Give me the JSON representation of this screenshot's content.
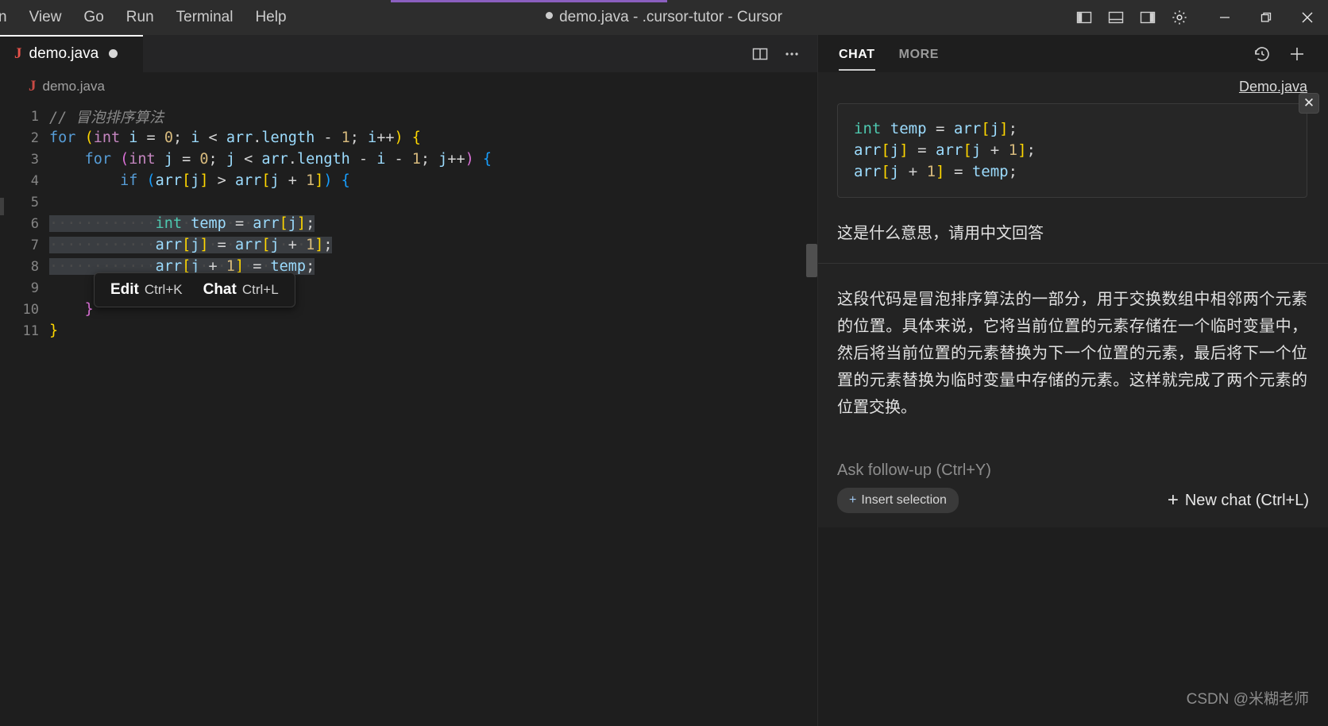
{
  "titlebar": {
    "menu_items": [
      "n",
      "View",
      "Go",
      "Run",
      "Terminal",
      "Help"
    ],
    "title": "demo.java - .cursor-tutor - Cursor",
    "layout_icons": [
      "toggle-primary-sidebar-icon",
      "toggle-panel-icon",
      "toggle-secondary-sidebar-icon",
      "gear-icon"
    ],
    "window_controls": [
      "minimize-icon",
      "maximize-icon",
      "close-icon"
    ]
  },
  "editor": {
    "tab": {
      "label": "demo.java",
      "file_icon": "java-icon",
      "dirty": true
    },
    "tab_actions": [
      "split-editor-icon",
      "more-actions-icon"
    ],
    "breadcrumb": "demo.java",
    "keybinding_widget": {
      "edit_label": "Edit",
      "edit_key": "Ctrl+K",
      "chat_label": "Chat",
      "chat_key": "Ctrl+L"
    },
    "lines": [
      {
        "num": "1",
        "indent": 0
      },
      {
        "num": "2",
        "indent": 0
      },
      {
        "num": "3",
        "indent": 1
      },
      {
        "num": "4",
        "indent": 2
      },
      {
        "num": "5",
        "indent": 2
      },
      {
        "num": "6",
        "indent": 3,
        "selected": true
      },
      {
        "num": "7",
        "indent": 3,
        "selected": true
      },
      {
        "num": "8",
        "indent": 3,
        "selected": true
      },
      {
        "num": "9",
        "indent": 2
      },
      {
        "num": "10",
        "indent": 1
      },
      {
        "num": "11",
        "indent": 0
      }
    ],
    "code_text": {
      "l1": "// 冒泡排序算法",
      "l2": "for (int i = 0; i < arr.length - 1; i++) {",
      "l3": "for (int j = 0; j < arr.length - i - 1; j++) {",
      "l4": "if (arr[j] > arr[j + 1]) {",
      "l6": "int temp = arr[j];",
      "l7": "arr[j] = arr[j + 1];",
      "l8": "arr[j + 1] = temp;",
      "l9": "}",
      "l10": "}",
      "l11": "}"
    }
  },
  "chat": {
    "tabs": [
      {
        "label": "CHAT",
        "active": true
      },
      {
        "label": "MORE",
        "active": false
      }
    ],
    "head_icons": [
      "history-icon",
      "new-chat-plus-icon"
    ],
    "file_link": "Demo.java",
    "code_block": {
      "lines": [
        "int temp = arr[j];",
        "arr[j] = arr[j + 1];",
        "arr[j + 1] = temp;"
      ],
      "close_label": "✕"
    },
    "question": "这是什么意思，请用中文回答",
    "answer": "这段代码是冒泡排序算法的一部分，用于交换数组中相邻两个元素的位置。具体来说，它将当前位置的元素存储在一个临时变量中，然后将当前位置的元素替换为下一个位置的元素，最后将下一个位置的元素替换为临时变量中存储的元素。这样就完成了两个元素的位置交换。",
    "input_placeholder": "Ask follow-up (Ctrl+Y)",
    "insert_selection_label": "Insert selection",
    "insert_selection_plus": "+",
    "new_chat_label": "New chat (Ctrl+L)",
    "new_chat_plus": "+"
  },
  "watermark": "CSDN @米糊老师",
  "colors": {
    "background": "#1e1e1e",
    "titlebar": "#2d2d2d",
    "accent_purple": "#8b5fbf",
    "java_red": "#e8524a",
    "chat_panel": "#232323",
    "selection": "#3a3d41"
  }
}
